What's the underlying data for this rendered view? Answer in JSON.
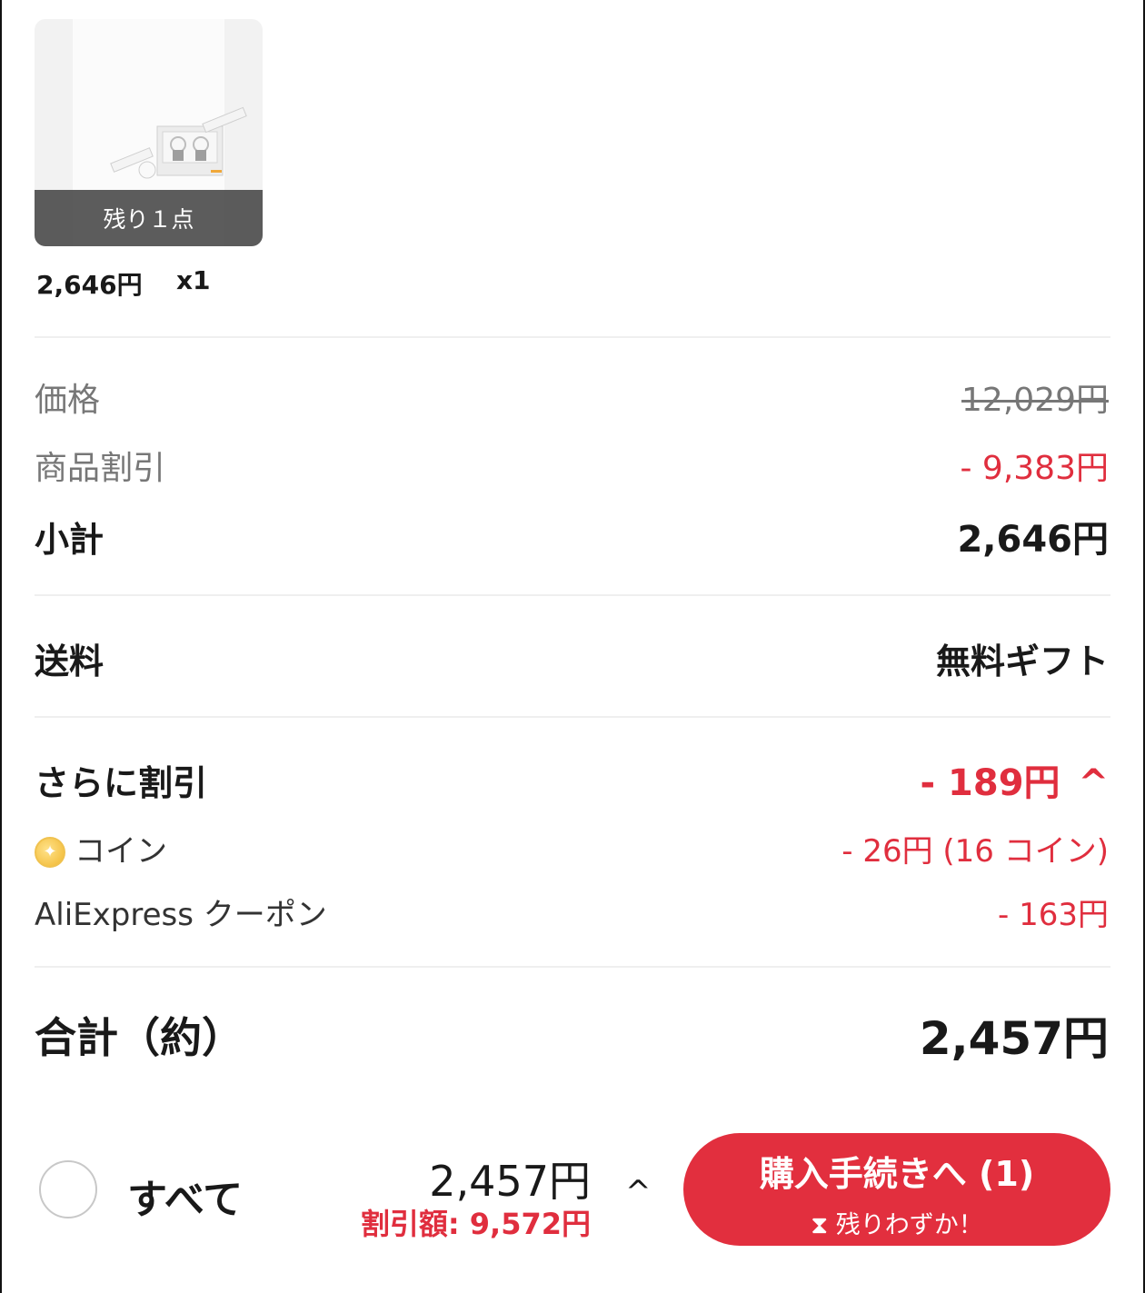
{
  "product": {
    "stock_label": "残り１点",
    "price": "2,646円",
    "qty": "x1"
  },
  "summary": {
    "price_label": "価格",
    "price_value": "12,029円",
    "discount_label": "商品割引",
    "discount_value": "- 9,383円",
    "subtotal_label": "小計",
    "subtotal_value": "2,646円",
    "shipping_label": "送料",
    "shipping_value": "無料ギフト",
    "extra_label": "さらに割引",
    "extra_value": "- 189円",
    "coin_label": "コイン",
    "coin_value": "- 26円 (16 コイン)",
    "coupon_label": "AliExpress クーポン",
    "coupon_value": "- 163円",
    "total_label": "合計（約）",
    "total_value": "2,457円"
  },
  "bottom": {
    "select_all": "すべて",
    "total": "2,457円",
    "discount": "割引額: 9,572円",
    "checkout": "購入手続きへ (1)",
    "urgency": "残りわずか！"
  },
  "colors": {
    "accent_red": "#e22f3e"
  }
}
